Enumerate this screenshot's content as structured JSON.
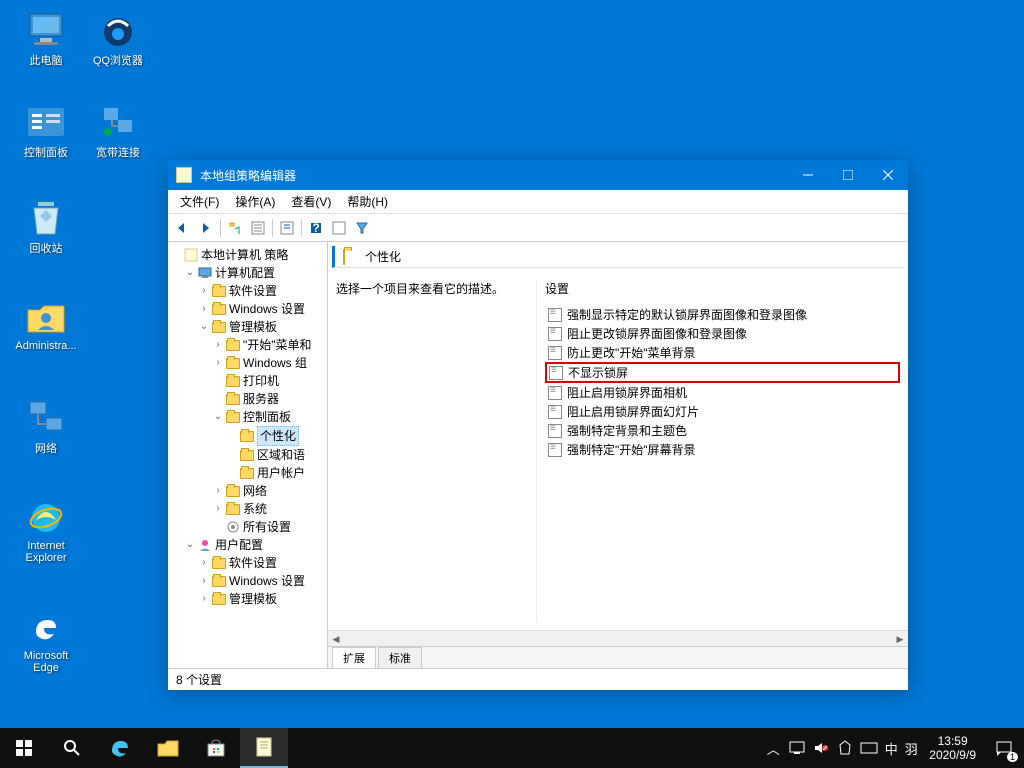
{
  "desktop": {
    "icons": [
      {
        "label": "此电脑",
        "icon": "pc"
      },
      {
        "label": "QQ浏览器",
        "icon": "qqbrowser"
      },
      {
        "label": "控制面板",
        "icon": "cpanel"
      },
      {
        "label": "宽带连接",
        "icon": "dialup"
      },
      {
        "label": "回收站",
        "icon": "recycle"
      },
      {
        "label": "Administra...",
        "icon": "userfolder"
      },
      {
        "label": "网络",
        "icon": "network"
      },
      {
        "label": "Internet Explorer",
        "icon": "ie"
      },
      {
        "label": "Microsoft Edge",
        "icon": "edge"
      }
    ]
  },
  "window": {
    "title": "本地组策略编辑器",
    "menus": {
      "file": "文件(F)",
      "action": "操作(A)",
      "view": "查看(V)",
      "help": "帮助(H)"
    }
  },
  "tree": {
    "root": "本地计算机 策略",
    "computer": "计算机配置",
    "software1": "软件设置",
    "windows1": "Windows 设置",
    "admin1": "管理模板",
    "startmenu": "\"开始\"菜单和",
    "wincomp": "Windows 组",
    "printers": "打印机",
    "server": "服务器",
    "cpanel": "控制面板",
    "personalization": "个性化",
    "region": "区域和语",
    "useracct": "用户帐户",
    "network": "网络",
    "system": "系统",
    "allsettings": "所有设置",
    "user": "用户配置",
    "software2": "软件设置",
    "windows2": "Windows 设置",
    "admin2": "管理模板"
  },
  "content": {
    "header": "个性化",
    "description": "选择一个项目来查看它的描述。",
    "listHeader": "设置",
    "items": [
      "强制显示特定的默认锁屏界面图像和登录图像",
      "阻止更改锁屏界面图像和登录图像",
      "防止更改\"开始\"菜单背景",
      "不显示锁屏",
      "阻止启用锁屏界面相机",
      "阻止启用锁屏界面幻灯片",
      "强制特定背景和主题色",
      "强制特定\"开始\"屏幕背景"
    ],
    "highlightedIndex": 3,
    "tabs": {
      "extended": "扩展",
      "standard": "标准"
    }
  },
  "status": "8 个设置",
  "taskbar": {
    "ime1": "中",
    "ime2": "羽",
    "time": "13:59",
    "date": "2020/9/9",
    "notifCount": "1"
  }
}
